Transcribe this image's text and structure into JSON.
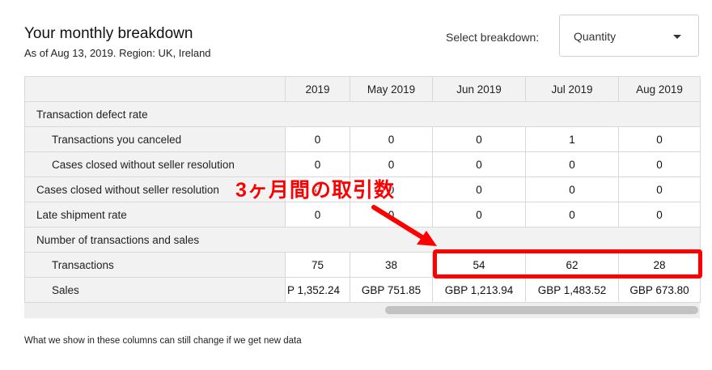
{
  "header": {
    "title": "Your monthly breakdown",
    "subtitle": "As of Aug 13, 2019. Region: UK, Ireland"
  },
  "breakdown_select": {
    "label": "Select breakdown:",
    "value": "Quantity"
  },
  "table": {
    "columns": [
      "2019",
      "May 2019",
      "Jun 2019",
      "Jul 2019",
      "Aug 2019"
    ],
    "rows": [
      {
        "label": "Transaction defect rate",
        "section": true,
        "values": []
      },
      {
        "label": "Transactions you canceled",
        "values": [
          "0",
          "0",
          "0",
          "1",
          "0"
        ]
      },
      {
        "label": "Cases closed without seller resolution",
        "values": [
          "0",
          "0",
          "0",
          "0",
          "0"
        ]
      },
      {
        "label": "Cases closed without seller resolution",
        "values": [
          "0",
          "0",
          "0",
          "0",
          "0"
        ]
      },
      {
        "label": "Late shipment rate",
        "values": [
          "0",
          "0",
          "0",
          "0",
          "0"
        ]
      },
      {
        "label": "Number of transactions and sales",
        "section": true,
        "values": []
      },
      {
        "label": "Transactions",
        "values": [
          "75",
          "38",
          "54",
          "62",
          "28"
        ]
      },
      {
        "label": "Sales",
        "values": [
          "P 1,352.24",
          "GBP 751.85",
          "GBP 1,213.94",
          "GBP 1,483.52",
          "GBP 673.80"
        ]
      }
    ]
  },
  "footnote": "What we show in these columns can still change if we get new data",
  "annotation": {
    "text": "3ヶ月間の取引数",
    "color": "#ff0000"
  }
}
